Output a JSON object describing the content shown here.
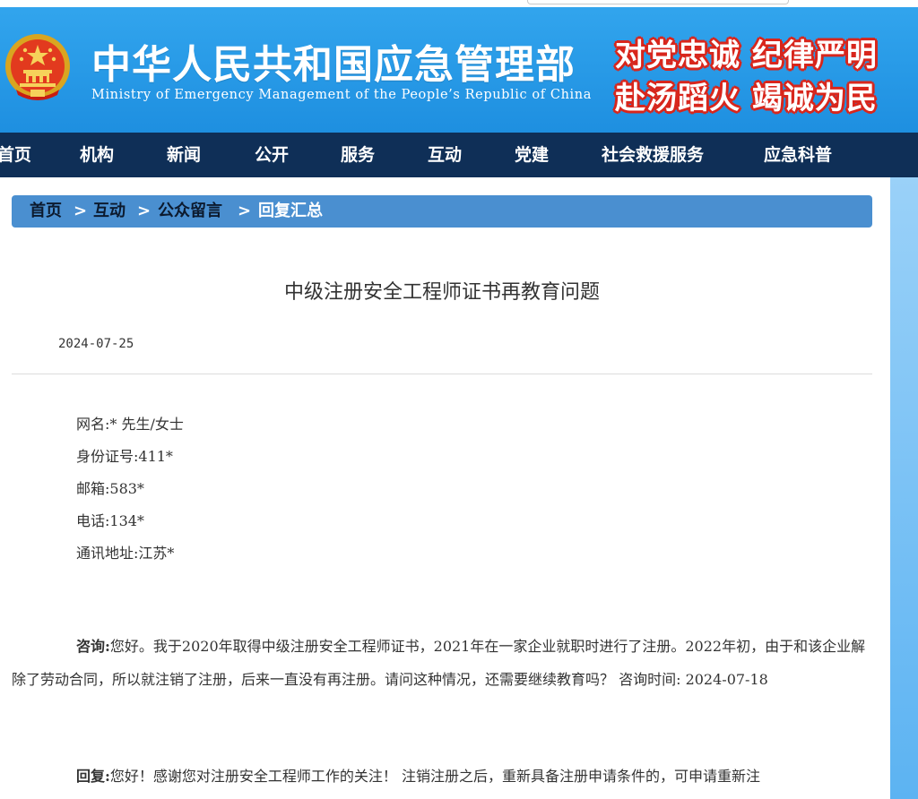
{
  "header": {
    "title": "中华人民共和国应急管理部",
    "subtitle": "Ministry of Emergency Management of the People’s Republic of China",
    "slogan_line1": "对党忠诚 纪律严明",
    "slogan_line2": "赴汤蹈火 竭诚为民",
    "emblem_icon": "national-emblem-icon",
    "colors": {
      "banner": "#2196e8",
      "slogan_outline": "#d8261c",
      "nav": "#0f2f57"
    }
  },
  "nav": {
    "items": [
      {
        "label": "首页"
      },
      {
        "label": "机构"
      },
      {
        "label": "新闻"
      },
      {
        "label": "公开"
      },
      {
        "label": "服务"
      },
      {
        "label": "互动"
      },
      {
        "label": "党建"
      },
      {
        "label": "社会救援服务"
      },
      {
        "label": "应急科普"
      }
    ]
  },
  "breadcrumb": {
    "items": [
      "首页",
      "互动",
      "公众留言",
      "回复汇总"
    ],
    "separator": ">"
  },
  "article": {
    "title": "中级注册安全工程师证书再教育问题",
    "date": "2024-07-25",
    "info": {
      "name": "网名:* 先生/女士",
      "id_number": "身份证号:411*",
      "email": "邮箱:583*",
      "phone": "电话:134*",
      "address": "通讯地址:江苏*"
    },
    "question_label": "咨询:",
    "question_text": "您好。我于2020年取得中级注册安全工程师证书，2021年在一家企业就职时进行了注册。2022年初，由于和该企业解除了劳动合同，所以就注销了注册，后来一直没有再注册。请问这种情况，还需要继续教育吗？  咨询时间: 2024-07-18",
    "reply_label": "回复:",
    "reply_text": "您好！感谢您对注册安全工程师工作的关注！ 注销注册之后，重新具备注册申请条件的，可申请重新注"
  }
}
